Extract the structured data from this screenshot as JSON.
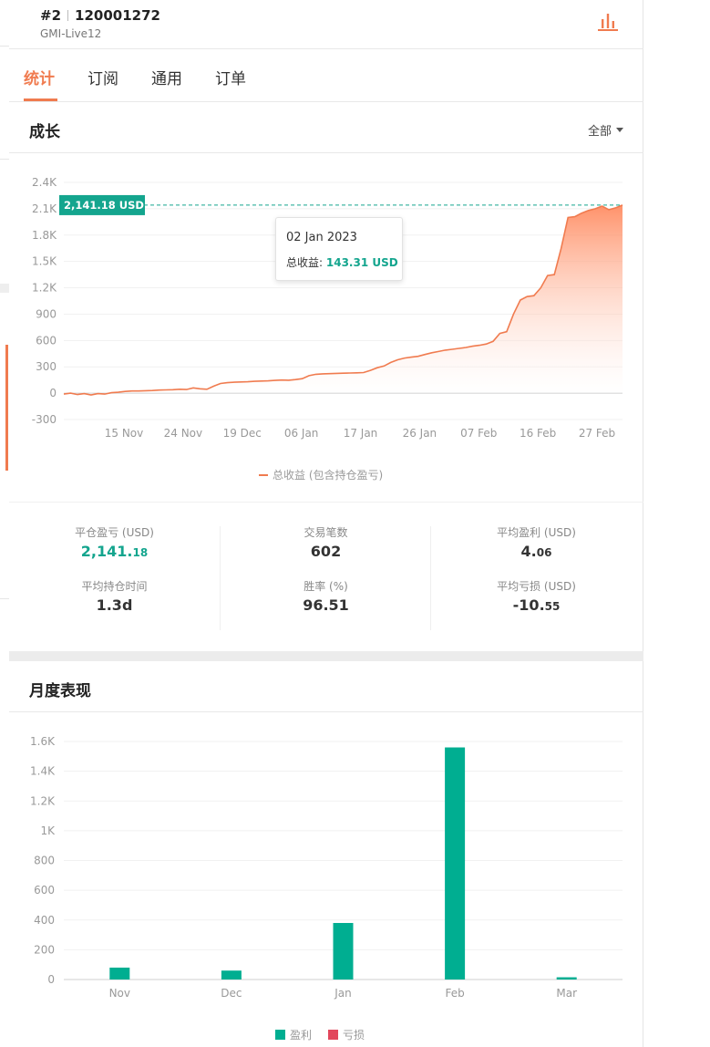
{
  "header": {
    "account_no": "#2",
    "account_id": "120001272",
    "server": "GMI-Live12",
    "icon": "bar-chart-icon"
  },
  "tabs": [
    {
      "label": "统计",
      "active": true
    },
    {
      "label": "订阅",
      "active": false
    },
    {
      "label": "通用",
      "active": false
    },
    {
      "label": "订单",
      "active": false
    }
  ],
  "growth": {
    "title": "成长",
    "filter": "全部",
    "current_label": "2,141.18 USD",
    "tooltip": {
      "date": "02 Jan 2023",
      "label": "总收益:",
      "value": "143.31 USD"
    },
    "legend": "总收益 (包含持仓盈亏)"
  },
  "stats": [
    [
      {
        "label": "平仓盈亏 (USD)",
        "value_main": "2,141.",
        "value_small": "18",
        "color": "#14a58e"
      },
      {
        "label": "平均持仓时间",
        "value_main": "1.3d",
        "value_small": ""
      }
    ],
    [
      {
        "label": "交易笔数",
        "value_main": "602",
        "value_small": ""
      },
      {
        "label": "胜率 (%)",
        "value_main": "96.51",
        "value_small": ""
      }
    ],
    [
      {
        "label": "平均盈利 (USD)",
        "value_main": "4.",
        "value_small": "06"
      },
      {
        "label": "平均亏损 (USD)",
        "value_main": "-10.",
        "value_small": "55"
      }
    ]
  ],
  "monthly": {
    "title": "月度表现",
    "legend": [
      {
        "label": "盈利",
        "color": "#00ae91"
      },
      {
        "label": "亏损",
        "color": "#e2475c"
      }
    ]
  },
  "chart_data": [
    {
      "type": "area",
      "ylim": [
        -300,
        2400
      ],
      "yticks": [
        -300,
        0,
        300,
        600,
        900,
        1200,
        1500,
        1800,
        2100,
        2400
      ],
      "ytick_labels": [
        "-300",
        "0",
        "300",
        "600",
        "900",
        "1.2K",
        "1.5K",
        "1.8K",
        "2.1K",
        "2.4K"
      ],
      "xtick_labels": [
        "15 Nov",
        "24 Nov",
        "19 Dec",
        "06 Jan",
        "17 Jan",
        "26 Jan",
        "07 Feb",
        "16 Feb",
        "27 Feb"
      ],
      "series": [
        {
          "name": "总收益 (包含持仓盈亏)",
          "color": "#f07b4f",
          "x": [
            0,
            1,
            2,
            3,
            4,
            5,
            6,
            7,
            8,
            9,
            10,
            11,
            12,
            13,
            14,
            15,
            16,
            17,
            18,
            19,
            20,
            21,
            22,
            23,
            24,
            25,
            26,
            27,
            28,
            29,
            30,
            31,
            32,
            33,
            34,
            35,
            36,
            37,
            38,
            39,
            40,
            41,
            42,
            43,
            44,
            45,
            46,
            47,
            48,
            49,
            50,
            51,
            52,
            53,
            54,
            55,
            56,
            57,
            58,
            59,
            60,
            61,
            62,
            63,
            64,
            65,
            66,
            67,
            68,
            69,
            70,
            71,
            72,
            73,
            74,
            75,
            76,
            77,
            78,
            79,
            80,
            81,
            82
          ],
          "y": [
            -10,
            0,
            -15,
            -5,
            -20,
            -5,
            -10,
            5,
            10,
            20,
            25,
            25,
            28,
            30,
            35,
            38,
            40,
            45,
            42,
            60,
            50,
            45,
            80,
            110,
            120,
            125,
            128,
            130,
            135,
            138,
            140,
            145,
            150,
            148,
            155,
            165,
            200,
            215,
            220,
            222,
            225,
            228,
            230,
            232,
            235,
            260,
            290,
            310,
            350,
            380,
            400,
            410,
            420,
            440,
            460,
            475,
            490,
            500,
            510,
            520,
            535,
            545,
            560,
            590,
            680,
            700,
            900,
            1060,
            1100,
            1110,
            1200,
            1340,
            1350,
            1650,
            2000,
            2010,
            2050,
            2080,
            2100,
            2130,
            2090,
            2110,
            2141.18
          ]
        }
      ],
      "highlight": {
        "x": 30,
        "date": "02 Jan 2023",
        "value": 143.31
      }
    },
    {
      "type": "bar",
      "ylim": [
        0,
        1600
      ],
      "yticks": [
        0,
        200,
        400,
        600,
        800,
        1000,
        1200,
        1400,
        1600
      ],
      "ytick_labels": [
        "0",
        "200",
        "400",
        "600",
        "800",
        "1K",
        "1.2K",
        "1.4K",
        "1.6K"
      ],
      "categories": [
        "Nov",
        "Dec",
        "Jan",
        "Feb",
        "Mar"
      ],
      "series": [
        {
          "name": "盈利",
          "color": "#00ae91",
          "values": [
            80,
            60,
            380,
            1560,
            15
          ]
        },
        {
          "name": "亏损",
          "color": "#e2475c",
          "values": [
            0,
            0,
            0,
            0,
            0
          ]
        }
      ]
    }
  ]
}
